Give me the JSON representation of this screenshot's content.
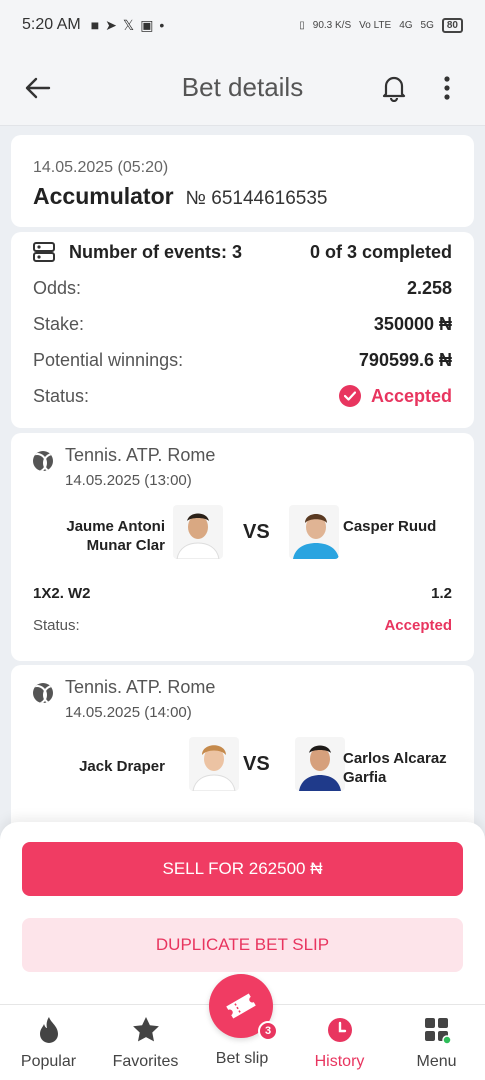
{
  "status_bar": {
    "time": "5:20 AM",
    "net_speed": "90.3 K/S",
    "vo_lte": "Vo LTE",
    "net1": "4G",
    "net2": "5G",
    "battery": "80"
  },
  "header": {
    "title": "Bet details"
  },
  "bet": {
    "date": "14.05.2025 (05:20)",
    "type": "Accumulator",
    "number": "№ 65144616535"
  },
  "summary": {
    "events_label": "Number of events: 3",
    "completed": "0 of 3 completed",
    "odds_label": "Odds:",
    "odds_value": "2.258",
    "stake_label": "Stake:",
    "stake_value": "350000 ₦",
    "potential_label": "Potential winnings:",
    "potential_value": "790599.6 ₦",
    "status_label": "Status:",
    "status_value": "Accepted"
  },
  "events": [
    {
      "league": "Tennis. ATP. Rome",
      "date": "14.05.2025 (13:00)",
      "player1": "Jaume Antoni Munar Clar",
      "player2": "Casper Ruud",
      "vs": "VS",
      "market": "1X2. W2",
      "odds": "1.2",
      "status_label": "Status:",
      "status_value": "Accepted"
    },
    {
      "league": "Tennis. ATP. Rome",
      "date": "14.05.2025 (14:00)",
      "player1": "Jack Draper",
      "player2": "Carlos Alcaraz Garfia",
      "vs": "VS"
    }
  ],
  "actions": {
    "sell": "SELL FOR 262500 ₦",
    "duplicate": "DUPLICATE BET SLIP"
  },
  "nav": {
    "popular": "Popular",
    "favorites": "Favorites",
    "betslip": "Bet slip",
    "betslip_count": "3",
    "history": "History",
    "menu": "Menu"
  },
  "colors": {
    "accent": "#f03c63",
    "accepted": "#e8355f"
  }
}
